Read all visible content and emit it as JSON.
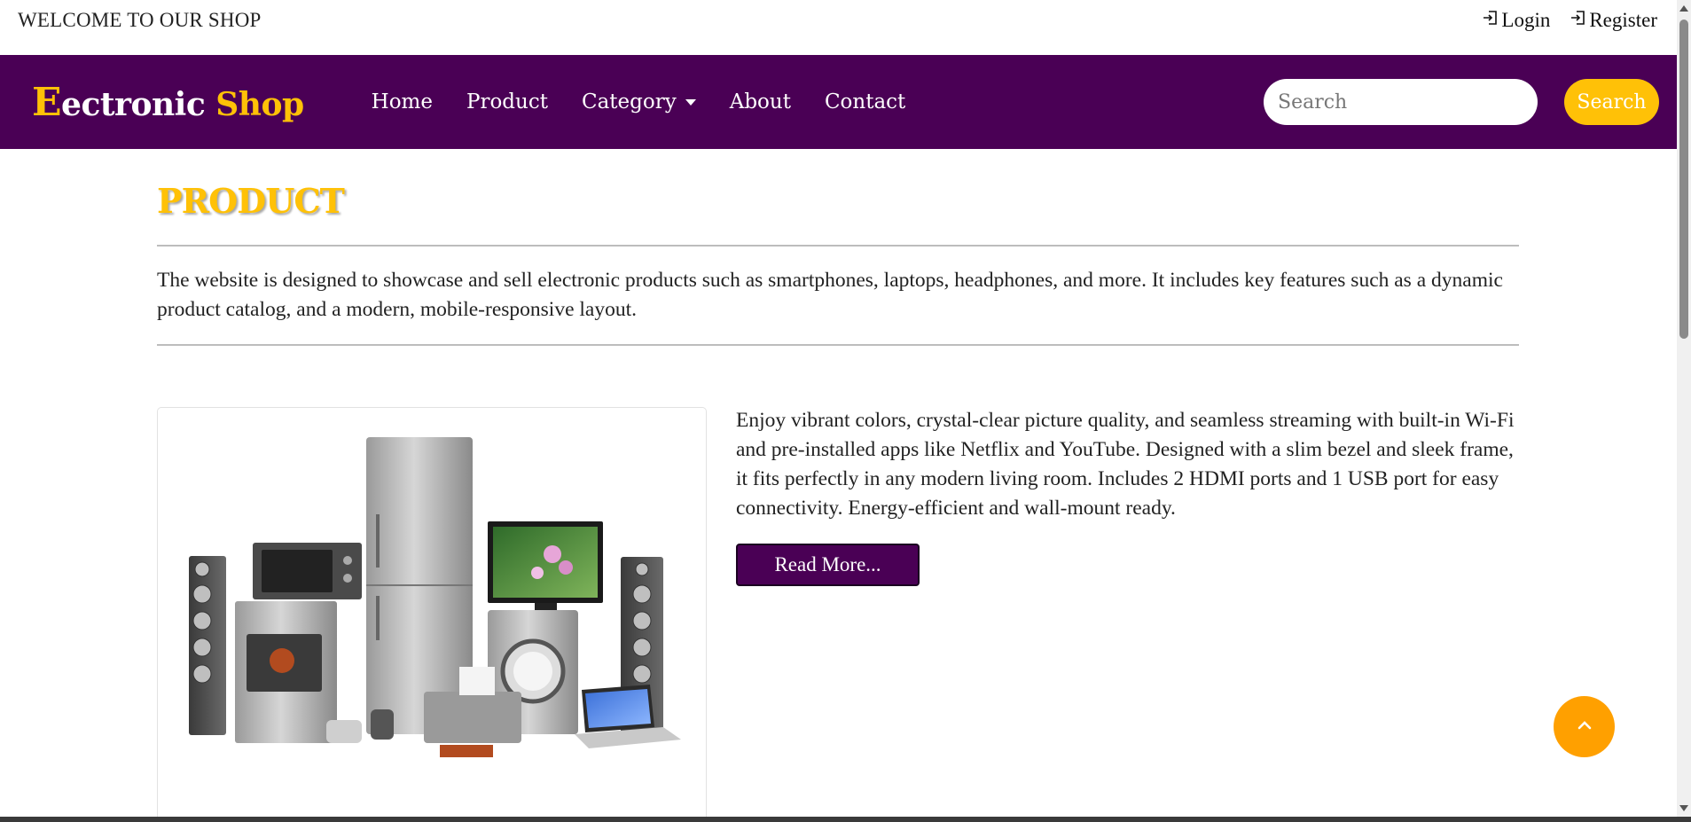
{
  "topbar": {
    "welcome": "WELCOME TO OUR SHOP",
    "login_label": "Login",
    "register_label": "Register",
    "login_icon": "login-icon",
    "register_icon": "register-icon"
  },
  "navbar": {
    "brand_first": "E",
    "brand_rest": "ectronic",
    "brand_accent": "Shop",
    "links": {
      "home": "Home",
      "product": "Product",
      "category": "Category",
      "about": "About",
      "contact": "Contact"
    },
    "search_placeholder": "Search",
    "search_button": "Search",
    "colors": {
      "background": "#4a0055",
      "accent": "#ffc107"
    }
  },
  "main": {
    "title": "PRODUCT",
    "intro": "The website is designed to showcase and sell electronic products such as smartphones, laptops, headphones, and more. It includes key features such as a dynamic product catalog, and a modern, mobile-responsive layout.",
    "product": {
      "description": "Enjoy vibrant colors, crystal-clear picture quality, and seamless streaming with built-in Wi-Fi and pre-installed apps like Netflix and YouTube. Designed with a slim bezel and sleek frame, it fits perfectly in any modern living room. Includes 2 HDMI ports and 1 USB port for easy connectivity. Energy-efficient and wall-mount ready.",
      "read_more": "Read More..."
    }
  },
  "back_to_top_icon": "chevron-up-icon"
}
